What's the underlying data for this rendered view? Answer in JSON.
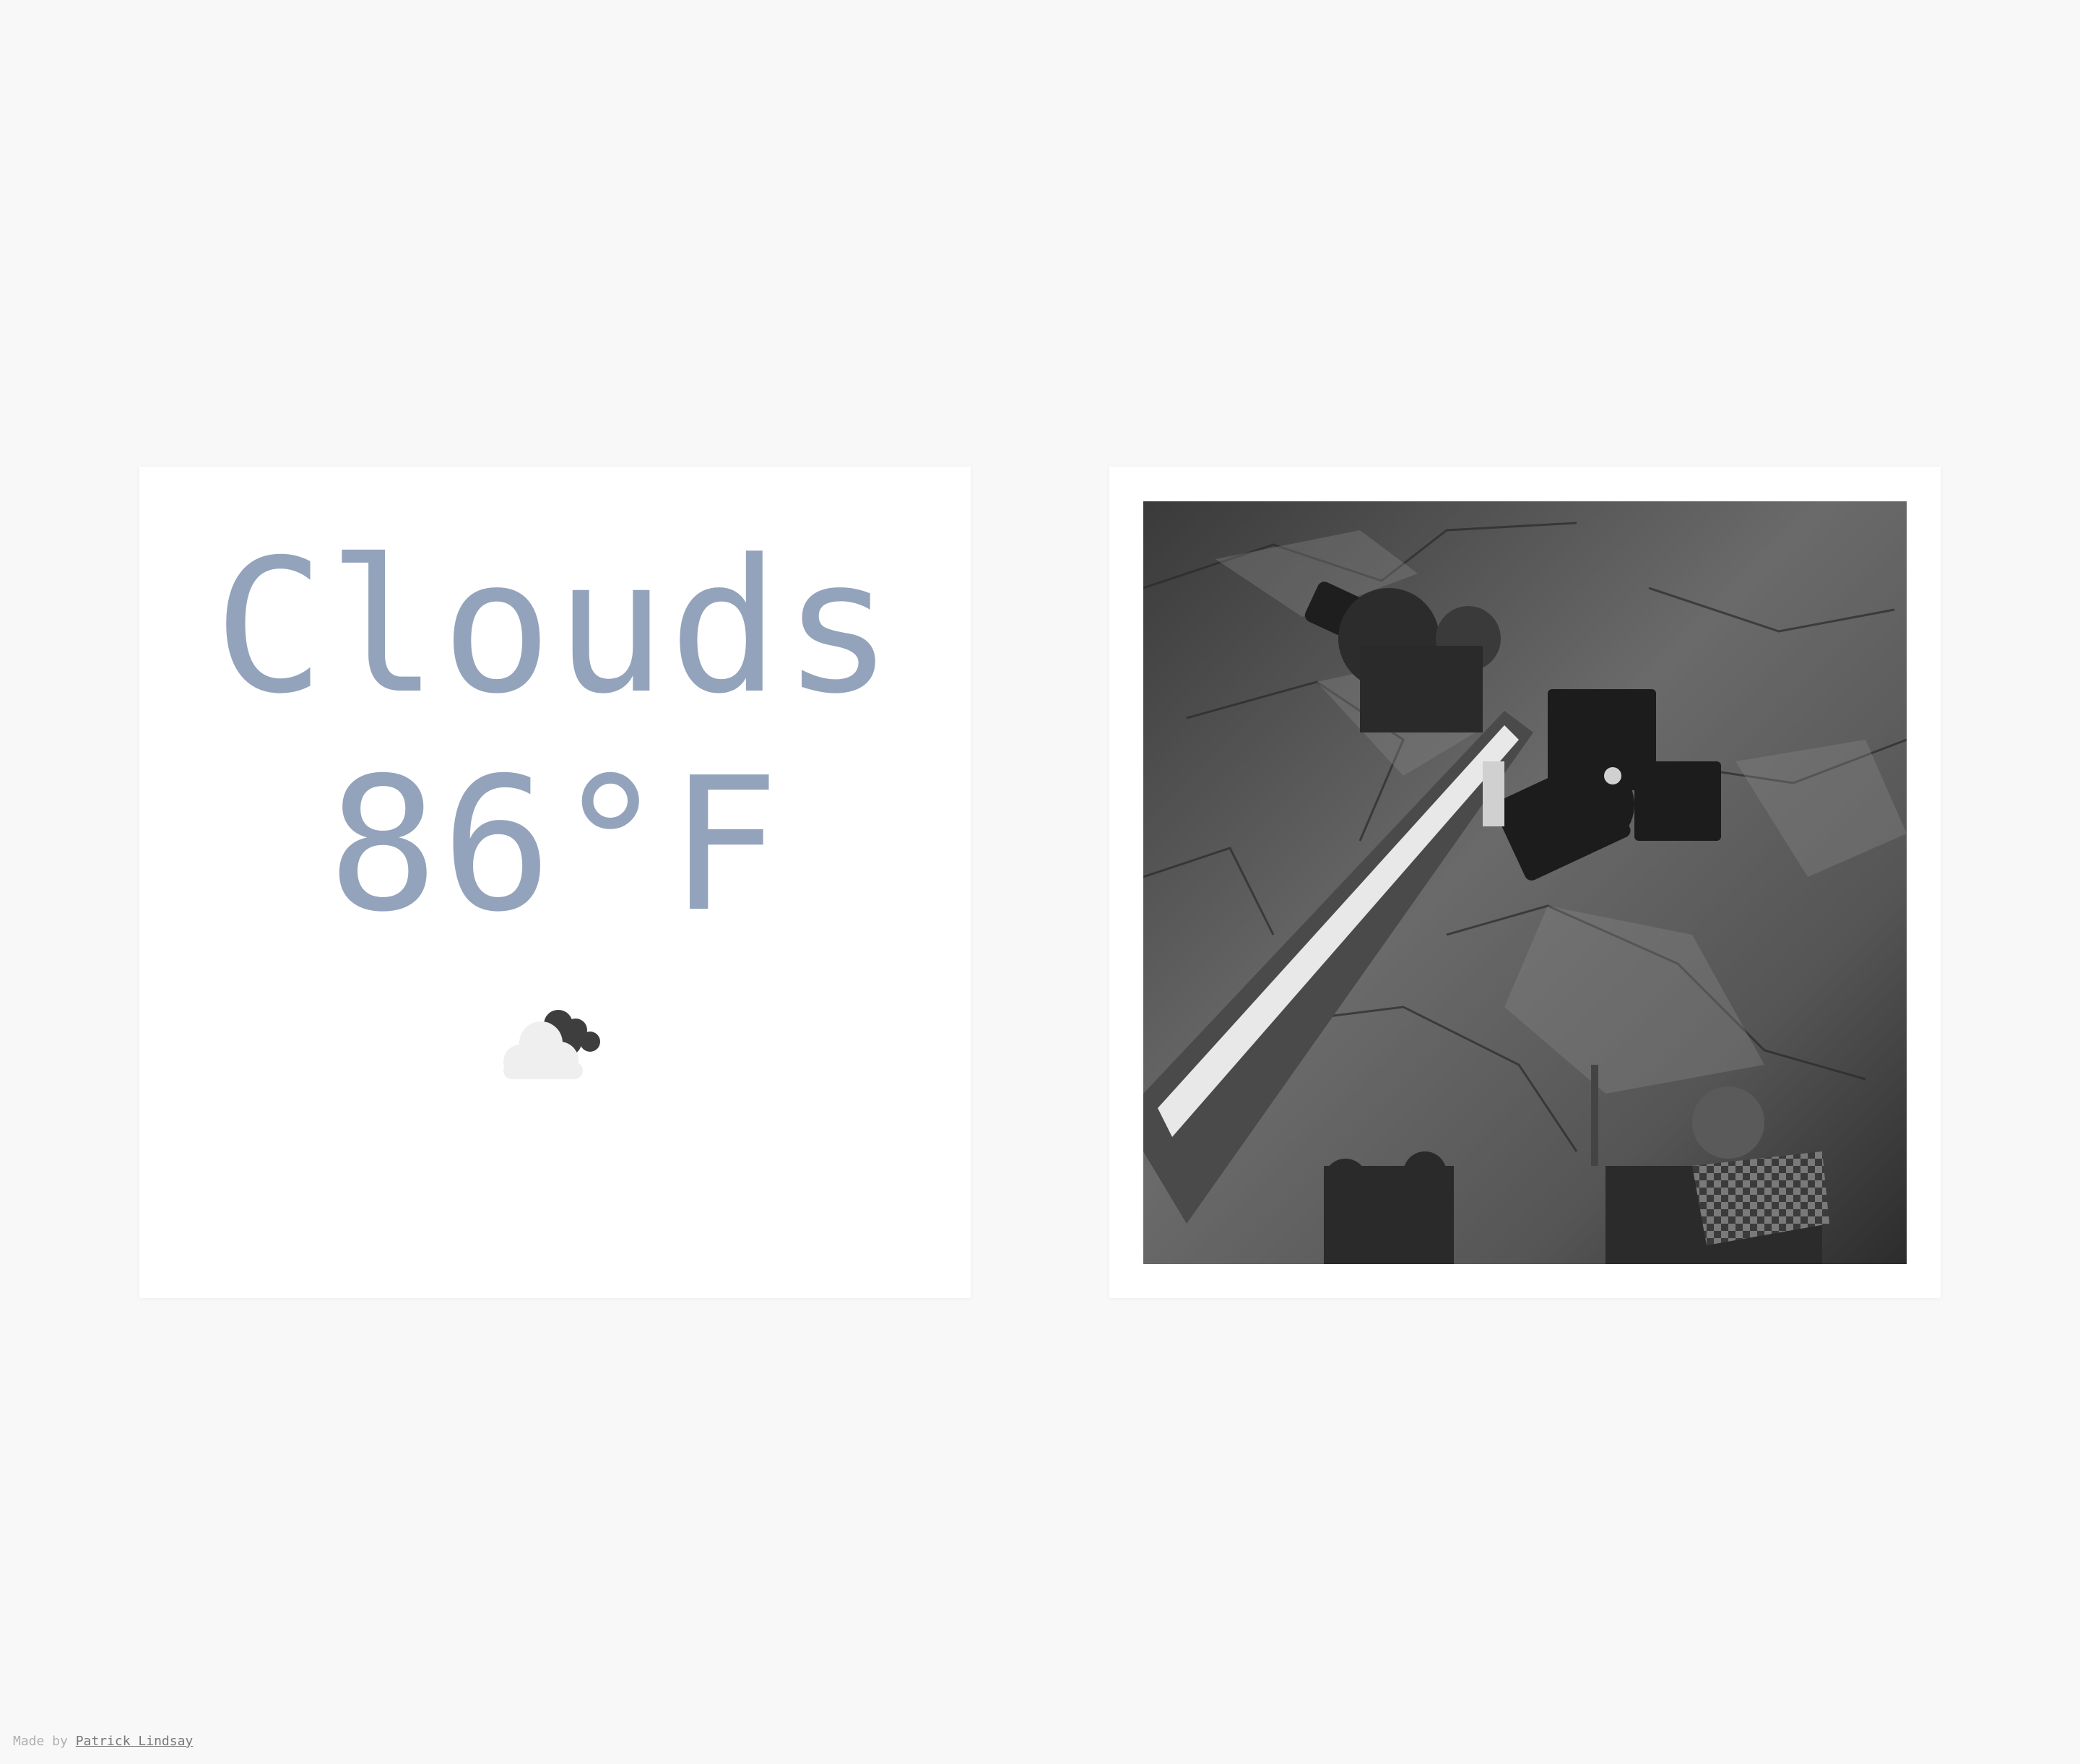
{
  "weather": {
    "condition": "Clouds",
    "temperature": "86°F",
    "icon": "cloudy-icon",
    "text_color": "#93a3bb"
  },
  "photo": {
    "description_icon": "mars-rover-arm-photo"
  },
  "footer": {
    "prefix": "Made by",
    "author": "Patrick Lindsay"
  }
}
